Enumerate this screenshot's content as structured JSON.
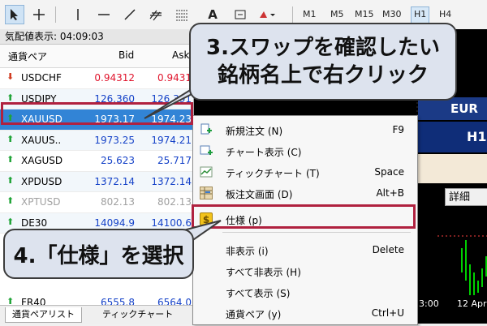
{
  "toolbar": {
    "timeframes": [
      "M1",
      "M5",
      "M15",
      "M30",
      "H1",
      "H4"
    ],
    "active_timeframe": "H1",
    "text_tool_label": "A"
  },
  "market_watch": {
    "title": "気配値表示: 04:09:03",
    "headers": {
      "symbol": "通貨ペア",
      "bid": "Bid",
      "ask": "Ask"
    },
    "rows": [
      {
        "symbol": "USDCHF",
        "bid": "0.94312",
        "ask": "0.9431",
        "direction": "down",
        "color": "red"
      },
      {
        "symbol": "USDJPY",
        "bid": "126.360",
        "ask": "126.391",
        "direction": "up",
        "color": "blue"
      },
      {
        "symbol": "XAUUSD",
        "bid": "1973.17",
        "ask": "1974.23",
        "direction": "up",
        "color": "blue",
        "selected": true
      },
      {
        "symbol": "XAUUS..",
        "bid": "1973.25",
        "ask": "1974.21",
        "direction": "up",
        "color": "blue"
      },
      {
        "symbol": "XAGUSD",
        "bid": "25.623",
        "ask": "25.717",
        "direction": "up",
        "color": "blue"
      },
      {
        "symbol": "XPDUSD",
        "bid": "1372.14",
        "ask": "1372.14",
        "direction": "up",
        "color": "blue"
      },
      {
        "symbol": "XPTUSD",
        "bid": "802.13",
        "ask": "802.13",
        "direction": "up",
        "color": "gray"
      },
      {
        "symbol": "DE30",
        "bid": "14094.9",
        "ask": "14100.6",
        "direction": "up",
        "color": "blue"
      },
      {
        "symbol": "FR40",
        "bid": "6555.8",
        "ask": "6564.0",
        "direction": "up",
        "color": "blue"
      }
    ],
    "tabs": [
      "通貨ペアリスト",
      "ティックチャート"
    ]
  },
  "chart": {
    "symbol_label": "EUR",
    "timeframe_label": "H1",
    "detail_button": "詳細",
    "axis_labels": [
      "13:00",
      "12 Apr"
    ]
  },
  "context_menu": {
    "items": [
      {
        "label": "新規注文 (N)",
        "shortcut": "F9",
        "icon": "new-order-icon"
      },
      {
        "label": "チャート表示 (C)",
        "shortcut": "",
        "icon": "chart-window-icon"
      },
      {
        "label": "ティックチャート (T)",
        "shortcut": "Space",
        "icon": "tick-chart-icon"
      },
      {
        "label": "板注文画面 (D)",
        "shortcut": "Alt+B",
        "icon": "depth-of-market-icon"
      },
      {
        "label": "仕様 (p)",
        "shortcut": "",
        "icon": "specification-icon"
      },
      {
        "label": "非表示 (i)",
        "shortcut": "Delete",
        "icon": ""
      },
      {
        "label": "すべて非表示 (H)",
        "shortcut": "",
        "icon": ""
      },
      {
        "label": "すべて表示 (S)",
        "shortcut": "",
        "icon": ""
      },
      {
        "label": "通貨ペア (y)",
        "shortcut": "Ctrl+U",
        "icon": ""
      }
    ]
  },
  "callouts": {
    "step3_line1": "3.スワップを確認したい",
    "step3_line2": "銘柄名上で右クリック",
    "step4": "4.「仕様」を選択"
  },
  "colors": {
    "selected_row": "#3284d6",
    "highlight_frame": "#b0213f",
    "callout_bg": "#dde3ee",
    "bid_up": "#1542c8",
    "bid_down": "#e0142c"
  }
}
